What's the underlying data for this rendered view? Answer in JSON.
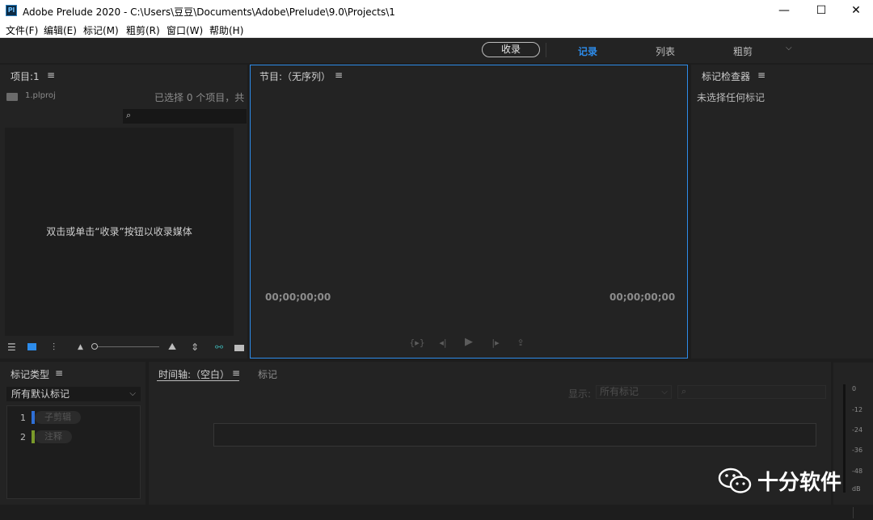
{
  "window": {
    "title": "Adobe Prelude 2020 - C:\\Users\\豆豆\\Documents\\Adobe\\Prelude\\9.0\\Projects\\1",
    "app_icon_text": "Pl",
    "minimize": "—",
    "maximize": "☐",
    "close": "✕"
  },
  "menu": [
    {
      "label": "文件(F)"
    },
    {
      "label": "编辑(E)"
    },
    {
      "label": "标记(M)"
    },
    {
      "label": "粗剪(R)"
    },
    {
      "label": "窗口(W)"
    },
    {
      "label": "帮助(H)"
    }
  ],
  "workspace": {
    "ingest_button": "收录",
    "tabs": [
      {
        "label": "记录",
        "active": true
      },
      {
        "label": "列表",
        "active": false
      },
      {
        "label": "粗剪",
        "active": false
      }
    ],
    "more_icon": "chevron-down-icon"
  },
  "project_panel": {
    "title": "项目:1",
    "project_file": "1.plproj",
    "selection_status": "已选择 0 个项目，共",
    "empty_message": "双击或单击“收录”按钮以收录媒体"
  },
  "program_panel": {
    "title": "节目:（无序列）",
    "timecode_left": "00;00;00;00",
    "timecode_right": "00;00;00;00"
  },
  "marker_inspector": {
    "title": "标记检查器",
    "empty_message": "未选择任何标记"
  },
  "marker_type_panel": {
    "title": "标记类型",
    "dropdown_value": "所有默认标记",
    "items": [
      {
        "number": "1",
        "label": "子剪辑",
        "color": "#2f6fd6"
      },
      {
        "number": "2",
        "label": "注释",
        "color": "#7a9a2a"
      }
    ]
  },
  "timeline_panel": {
    "tabs": [
      {
        "label": "时间轴:（空白）",
        "active": true
      },
      {
        "label": "标记",
        "active": false
      }
    ],
    "show_label": "显示:",
    "show_dropdown_value": "所有标记"
  },
  "audio_meter": {
    "labels": [
      "0",
      "-12",
      "-24",
      "-36",
      "-48",
      "dB"
    ]
  },
  "watermark": {
    "text": "十分软件"
  },
  "colors": {
    "accent": "#2d8ceb",
    "active_tab": "#2d8ceb",
    "panel_bg": "#232323"
  }
}
